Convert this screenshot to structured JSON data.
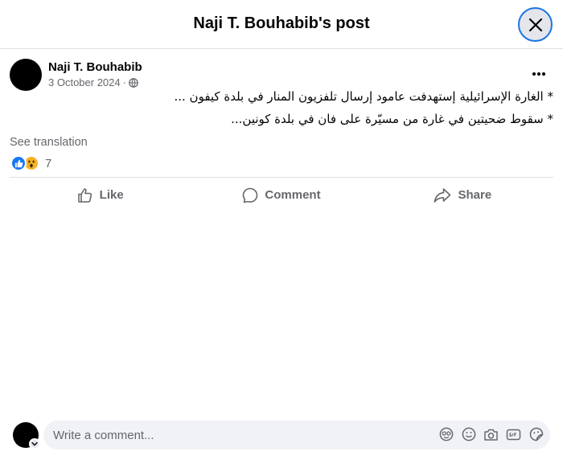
{
  "header": {
    "title": "Naji T. Bouhabib's post"
  },
  "post": {
    "author": "Naji T. Bouhabib",
    "date": "3 October 2024",
    "separator": "·",
    "lines": [
      "*  الغارة الإسرائيلية إستهدفت عامود إرسال تلفزيون المنار في بلدة كيفون ...",
      "*  سقوط ضحيتين في غارة من مسيّرة على فان في بلدة كونين..."
    ],
    "see_translation": "See translation",
    "reactions": {
      "count": "7",
      "types": [
        "like-icon",
        "wow-icon"
      ]
    }
  },
  "actions": {
    "like": "Like",
    "comment": "Comment",
    "share": "Share"
  },
  "composer": {
    "placeholder": "Write a comment...",
    "tools": [
      "avatar-sticker-icon",
      "emoji-icon",
      "camera-icon",
      "gif-icon",
      "sticker-icon"
    ]
  },
  "colors": {
    "accent": "#1877f2",
    "secondary_text": "#65676b",
    "wow": "#f7b125"
  }
}
